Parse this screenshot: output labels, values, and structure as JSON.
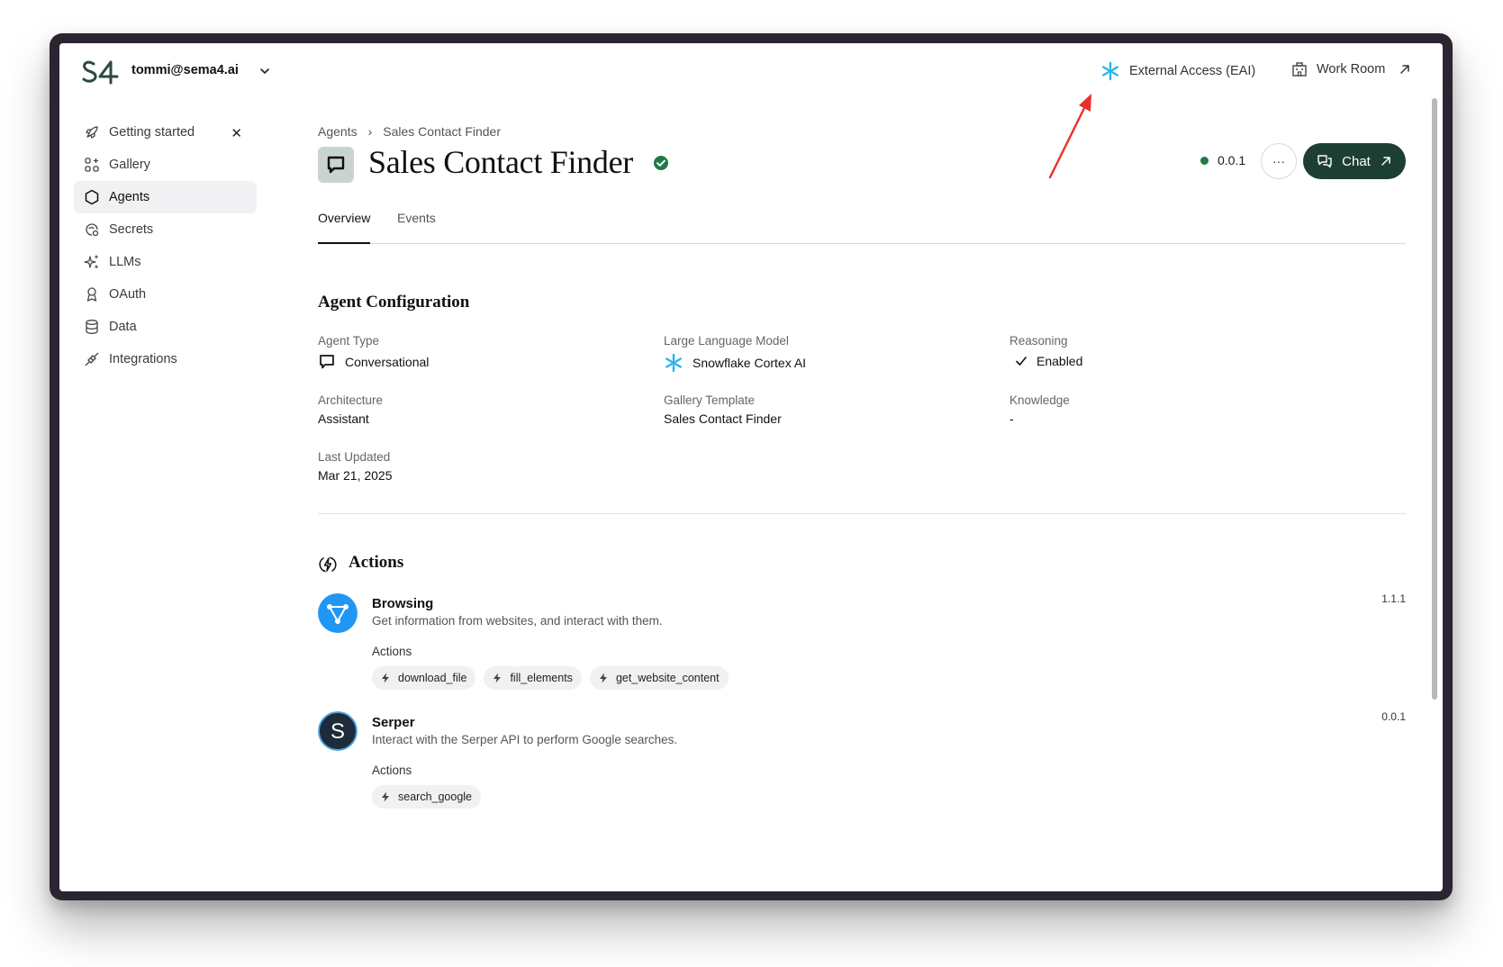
{
  "user": {
    "email": "tommi@sema4.ai"
  },
  "topnav": {
    "eai_label": "External Access (EAI)",
    "workroom_label": "Work Room"
  },
  "sidebar": {
    "items": [
      {
        "label": "Getting started",
        "icon": "rocket-icon"
      },
      {
        "label": "Gallery",
        "icon": "gallery-icon"
      },
      {
        "label": "Agents",
        "icon": "hexagon-icon"
      },
      {
        "label": "Secrets",
        "icon": "secrets-icon"
      },
      {
        "label": "LLMs",
        "icon": "sparkles-icon"
      },
      {
        "label": "OAuth",
        "icon": "oauth-icon"
      },
      {
        "label": "Data",
        "icon": "database-icon"
      },
      {
        "label": "Integrations",
        "icon": "plug-icon"
      }
    ],
    "close_symbol": "✕"
  },
  "breadcrumb": {
    "root": "Agents",
    "separator": "›",
    "current": "Sales Contact Finder"
  },
  "page": {
    "title": "Sales Contact Finder",
    "version": "0.0.1",
    "more": "···",
    "chat_label": "Chat"
  },
  "tabs": {
    "overview": "Overview",
    "events": "Events"
  },
  "config": {
    "title": "Agent Configuration",
    "agent_type_label": "Agent Type",
    "agent_type_value": "Conversational",
    "llm_label": "Large Language Model",
    "llm_value": "Snowflake Cortex AI",
    "reasoning_label": "Reasoning",
    "reasoning_value": "Enabled",
    "architecture_label": "Architecture",
    "architecture_value": "Assistant",
    "gallery_label": "Gallery Template",
    "gallery_value": "Sales Contact Finder",
    "knowledge_label": "Knowledge",
    "knowledge_value": "-",
    "updated_label": "Last Updated",
    "updated_value": "Mar 21, 2025"
  },
  "actions": {
    "title": "Actions",
    "packages": [
      {
        "name": "Browsing",
        "description": "Get information from websites, and interact with them.",
        "version": "1.1.1",
        "sub_label": "Actions",
        "actions": [
          "download_file",
          "fill_elements",
          "get_website_content"
        ]
      },
      {
        "name": "Serper",
        "description": "Interact with the Serper API to perform Google searches.",
        "version": "0.0.1",
        "sub_label": "Actions",
        "actions": [
          "search_google"
        ]
      }
    ]
  },
  "colors": {
    "brand_dark": "#1d3f33",
    "status_green": "#1f7a45",
    "snowflake_blue": "#29b5e8",
    "annotation_red": "#e8302a"
  }
}
